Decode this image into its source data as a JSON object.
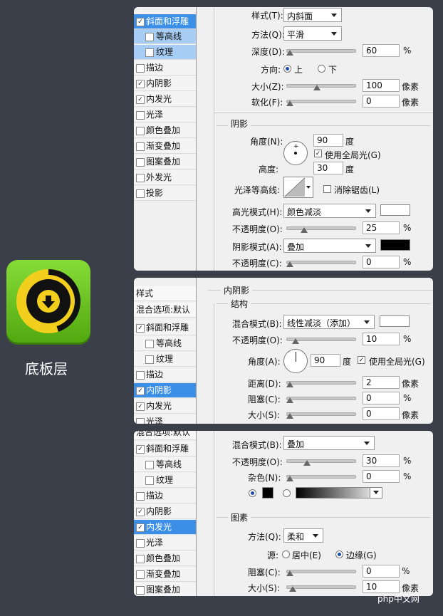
{
  "icon_label": "底板层",
  "watermark": "php中文网",
  "panel1": {
    "sidebar": [
      {
        "label": "斜面和浮雕",
        "checked": true
      },
      {
        "label": "等高线",
        "checked": false
      },
      {
        "label": "纹理",
        "checked": false
      },
      {
        "label": "描边",
        "checked": false
      },
      {
        "label": "内阴影",
        "checked": true
      },
      {
        "label": "内发光",
        "checked": true
      },
      {
        "label": "光泽",
        "checked": false
      },
      {
        "label": "颜色叠加",
        "checked": false
      },
      {
        "label": "渐变叠加",
        "checked": false
      },
      {
        "label": "图案叠加",
        "checked": false
      },
      {
        "label": "外发光",
        "checked": false
      },
      {
        "label": "投影",
        "checked": false
      }
    ],
    "style_label": "样式(T):",
    "style_value": "内斜面",
    "method_label": "方法(Q):",
    "method_value": "平滑",
    "depth_label": "深度(D):",
    "depth_value": "60",
    "depth_unit": "%",
    "direction_label": "方向:",
    "dir_up": "上",
    "dir_down": "下",
    "size_label": "大小(Z):",
    "size_value": "100",
    "size_unit": "像素",
    "soften_label": "软化(F):",
    "soften_value": "0",
    "soften_unit": "像素",
    "shadow_title": "阴影",
    "angle_label": "角度(N):",
    "angle_value": "90",
    "angle_unit": "度",
    "global_light": "使用全局光(G)",
    "altitude_label": "高度:",
    "altitude_value": "30",
    "altitude_unit": "度",
    "gloss_label": "光泽等高线:",
    "antialias": "消除锯齿(L)",
    "highlight_label": "高光模式(H):",
    "highlight_value": "颜色减淡",
    "opacity1_label": "不透明度(O):",
    "opacity1_value": "25",
    "opacity1_unit": "%",
    "shadowmode_label": "阴影模式(A):",
    "shadowmode_value": "叠加",
    "opacity2_label": "不透明度(C):",
    "opacity2_value": "0",
    "opacity2_unit": "%"
  },
  "panel2": {
    "sidebar": [
      {
        "label": "样式",
        "checked": null
      },
      {
        "label": "混合选项:默认",
        "checked": null
      },
      {
        "label": "斜面和浮雕",
        "checked": true
      },
      {
        "label": "等高线",
        "checked": false
      },
      {
        "label": "纹理",
        "checked": false
      },
      {
        "label": "描边",
        "checked": false
      },
      {
        "label": "内阴影",
        "checked": true
      },
      {
        "label": "内发光",
        "checked": true
      },
      {
        "label": "光泽",
        "checked": false
      }
    ],
    "title": "内阴影",
    "structure": "结构",
    "blend_label": "混合模式(B):",
    "blend_value": "线性减淡（添加）",
    "opacity_label": "不透明度(O):",
    "opacity_value": "10",
    "opacity_unit": "%",
    "angle_label": "角度(A):",
    "angle_value": "90",
    "angle_unit": "度",
    "global_light": "使用全局光(G)",
    "distance_label": "距离(D):",
    "distance_value": "2",
    "distance_unit": "像素",
    "choke_label": "阻塞(C):",
    "choke_value": "0",
    "choke_unit": "%",
    "size_label": "大小(S):",
    "size_value": "0",
    "size_unit": "像素"
  },
  "panel3": {
    "sidebar": [
      {
        "label": "混合选项:默认",
        "checked": null
      },
      {
        "label": "斜面和浮雕",
        "checked": true
      },
      {
        "label": "等高线",
        "checked": false
      },
      {
        "label": "纹理",
        "checked": false
      },
      {
        "label": "描边",
        "checked": false
      },
      {
        "label": "内阴影",
        "checked": true
      },
      {
        "label": "内发光",
        "checked": true
      },
      {
        "label": "光泽",
        "checked": false
      },
      {
        "label": "颜色叠加",
        "checked": false
      },
      {
        "label": "渐变叠加",
        "checked": false
      },
      {
        "label": "图案叠加",
        "checked": false
      }
    ],
    "blend_label": "混合模式(B):",
    "blend_value": "叠加",
    "opacity_label": "不透明度(O):",
    "opacity_value": "30",
    "opacity_unit": "%",
    "noise_label": "杂色(N):",
    "noise_value": "0",
    "noise_unit": "%",
    "element_title": "图素",
    "method_label": "方法(Q):",
    "method_value": "柔和",
    "source_label": "源:",
    "source_center": "居中(E)",
    "source_edge": "边缘(G)",
    "choke_label": "阻塞(C):",
    "choke_value": "0",
    "choke_unit": "%",
    "size_label": "大小(S):",
    "size_value": "10",
    "size_unit": "像素"
  }
}
